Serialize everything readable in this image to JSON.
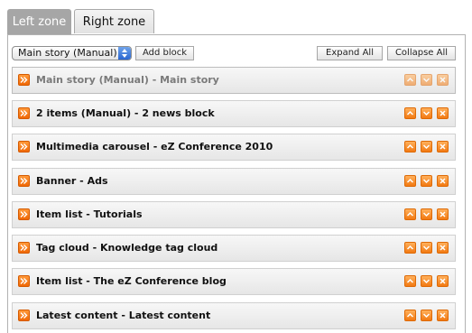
{
  "tabs": [
    {
      "label": "Left zone",
      "active": true
    },
    {
      "label": "Right zone",
      "active": false
    }
  ],
  "toolbar": {
    "block_type_select": "Main story (Manual)",
    "add_block_label": "Add block",
    "expand_all_label": "Expand All",
    "collapse_all_label": "Collapse All"
  },
  "blocks": [
    {
      "title": "Main story (Manual) - Main story",
      "disabled_look": true
    },
    {
      "title": "2 items (Manual) - 2 news block"
    },
    {
      "title": "Multimedia carousel - eZ Conference 2010"
    },
    {
      "title": "Banner - Ads"
    },
    {
      "title": "Item list - Tutorials"
    },
    {
      "title": "Tag cloud - Knowledge tag cloud"
    },
    {
      "title": "Item list - The eZ Conference blog"
    },
    {
      "title": "Latest content - Latest content"
    }
  ],
  "icons": {
    "expand": "double-chevron-right-icon",
    "move_up": "chevron-up-icon",
    "move_down": "chevron-down-icon",
    "remove": "close-icon",
    "select_arrows": "updown-arrows-icon"
  },
  "colors": {
    "active_tab": "#a6a6a6",
    "icon_orange": "#f27a12",
    "select_blue": "#2b67d1",
    "row_bg": "#eeeeee"
  }
}
